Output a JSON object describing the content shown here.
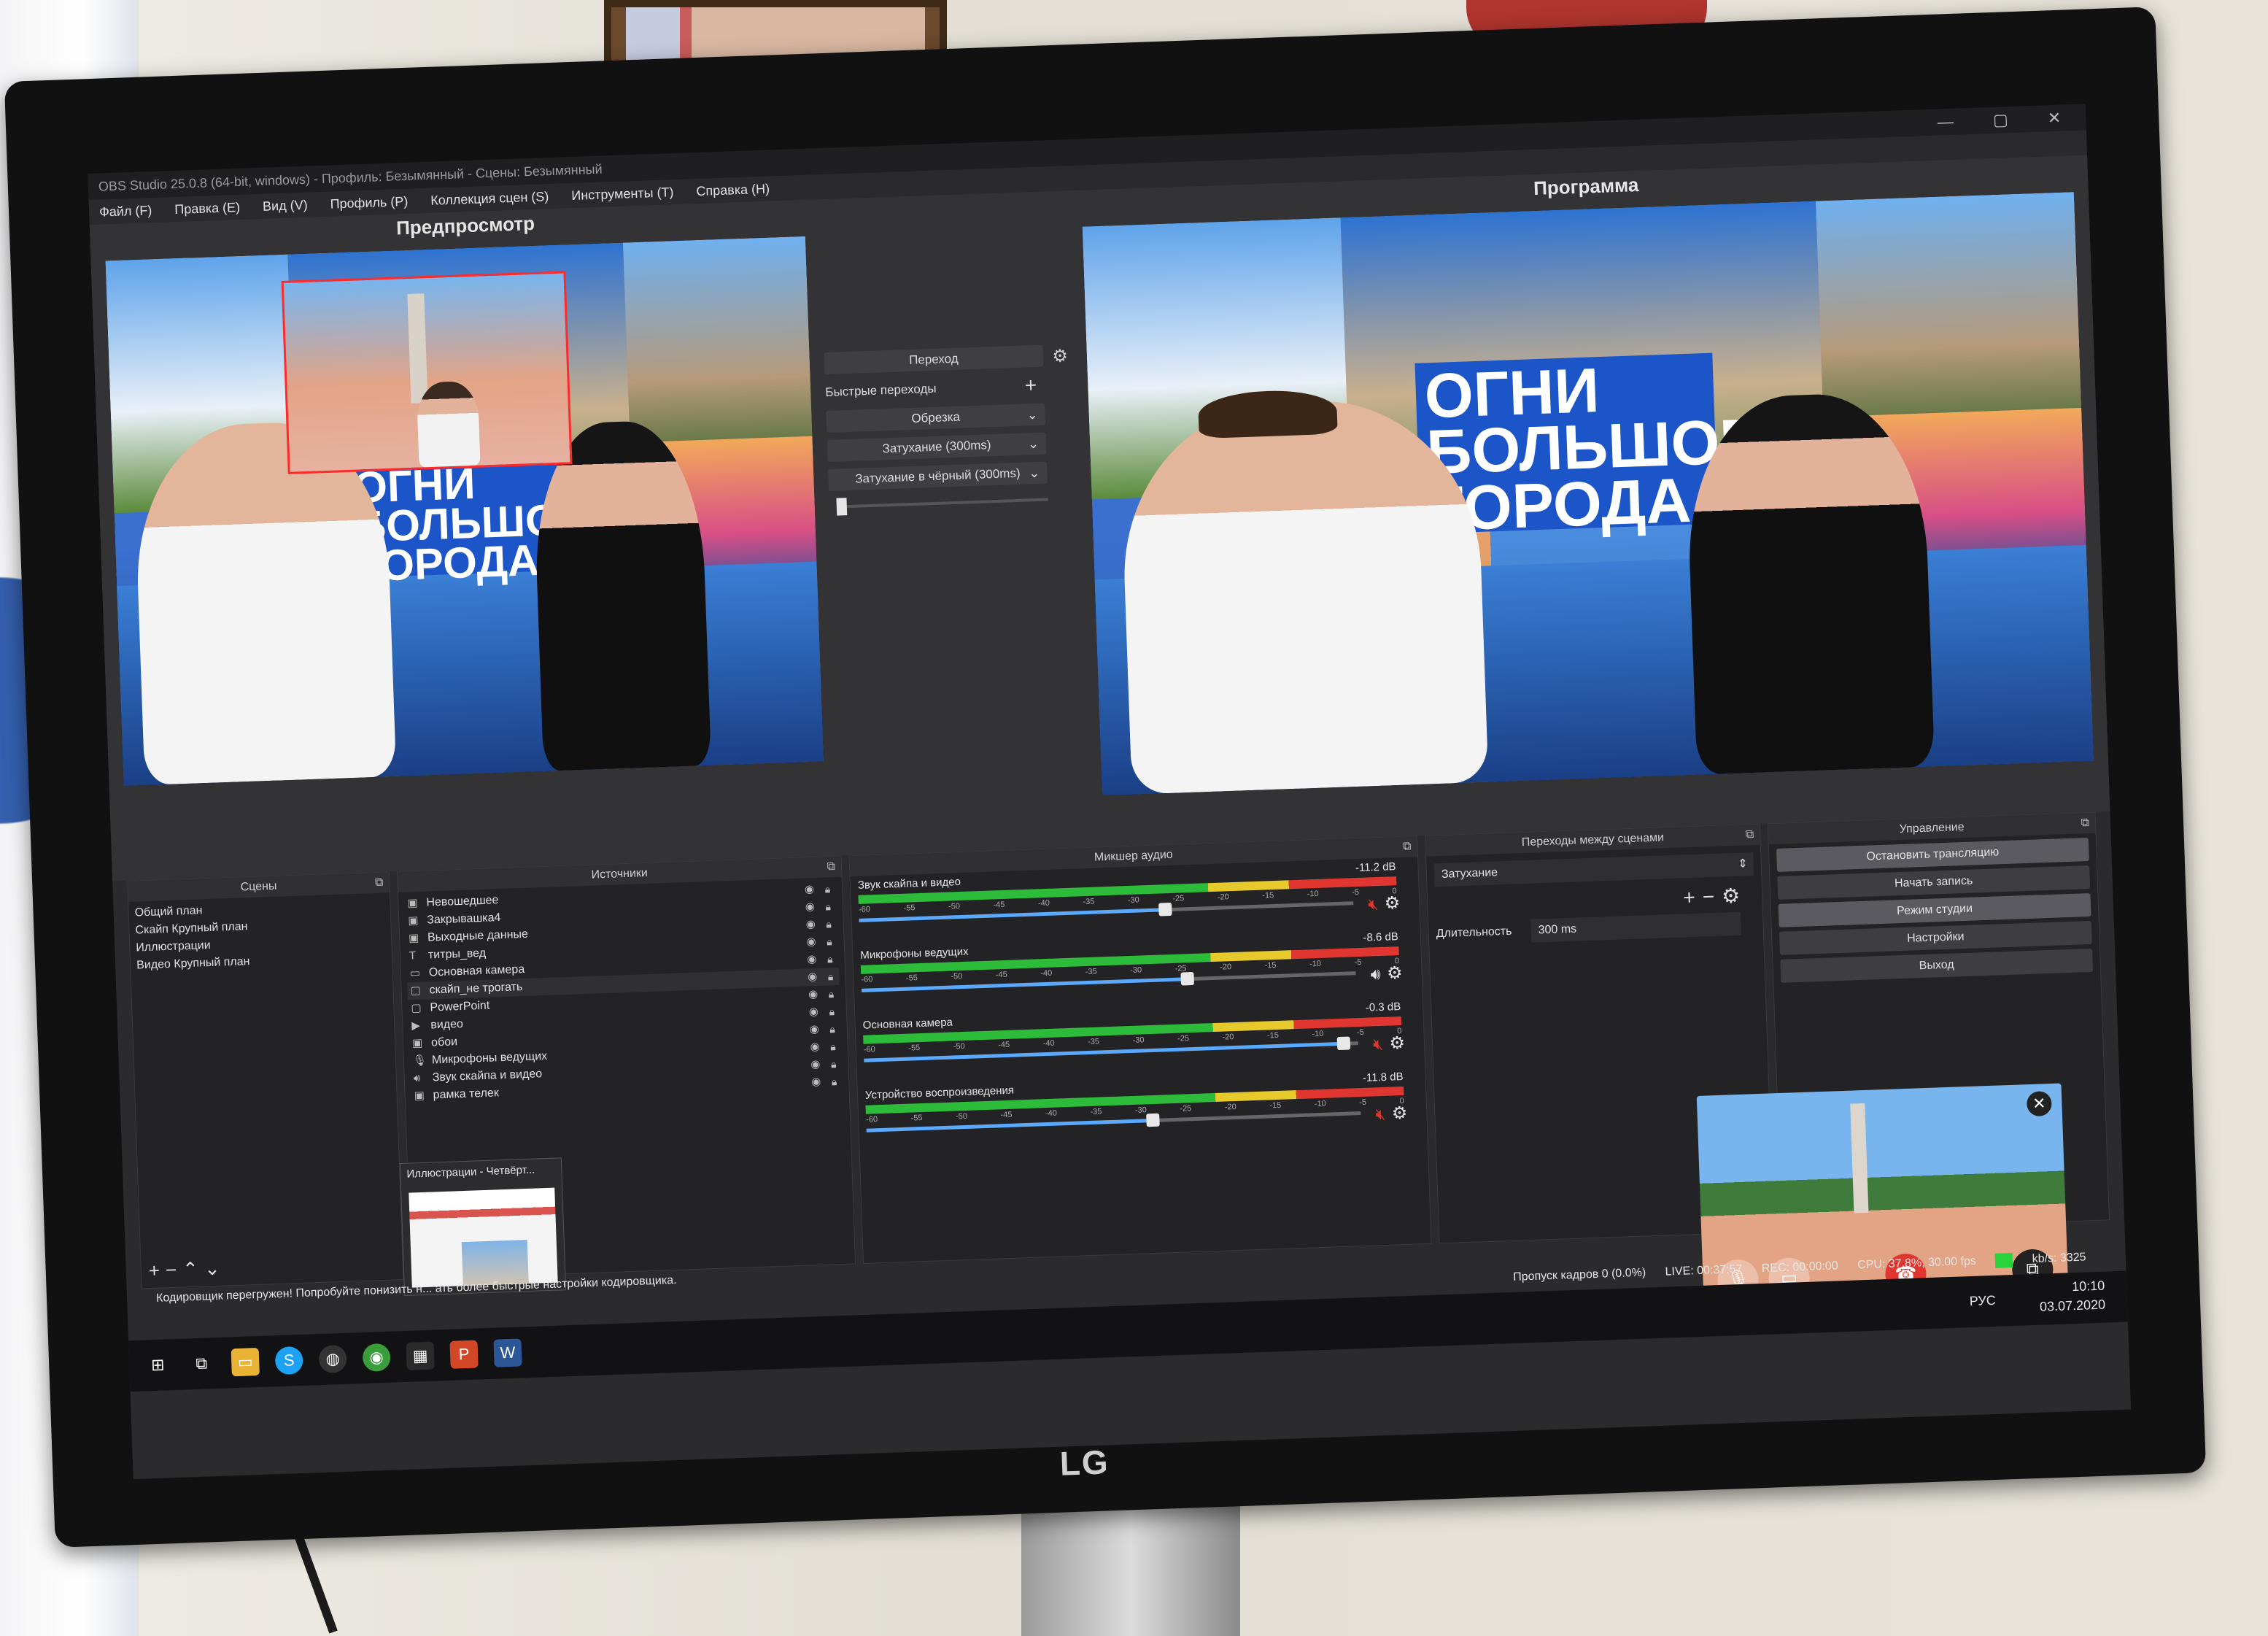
{
  "window": {
    "title": "OBS Studio 25.0.8 (64-bit, windows) - Профиль: Безымянный - Сцены: Безымянный"
  },
  "menu": [
    "Файл (F)",
    "Правка (E)",
    "Вид (V)",
    "Профиль (P)",
    "Коллекция сцен (S)",
    "Инструменты (T)",
    "Справка (H)"
  ],
  "preview": {
    "title": "Предпросмотр",
    "banner_text": "ОГНИ БОЛЬШОГО ГОРОДА"
  },
  "program": {
    "title": "Программа",
    "banner_text": "ОГНИ БОЛЬШОГО ГОРОДА"
  },
  "transition_panel": {
    "transition_button": "Переход",
    "quick_label": "Быстрые переходы",
    "quick_items": [
      "Обрезка",
      "Затухание (300ms)",
      "Затухание в чёрный (300ms)"
    ]
  },
  "scenes": {
    "title": "Сцены",
    "items": [
      "Общий план",
      "Скайп Крупный план",
      "Иллюстрации",
      "Видео Крупный план"
    ]
  },
  "sources": {
    "title": "Источники",
    "items": [
      "Невошедшее",
      "Закрывашка4",
      "Выходные данные",
      "титры_вед",
      "Основная камера",
      "скайп_не трогать",
      "PowerPoint",
      "видео",
      "обои",
      "Микрофоны ведущих",
      "Звук скайпа и видео",
      "рамка телек"
    ]
  },
  "mixer": {
    "title": "Микшер аудио",
    "channels": [
      {
        "name": "Звук скайпа и видео",
        "db": "-11.2 dB",
        "level": 0.62,
        "muted": true
      },
      {
        "name": "Микрофоны ведущих",
        "db": "-8.6 dB",
        "level": 0.66,
        "muted": false
      },
      {
        "name": "Основная камера",
        "db": "-0.3 dB",
        "level": 0.97,
        "muted": true
      },
      {
        "name": "Устройство воспроизведения",
        "db": "-11.8 dB",
        "level": 0.58,
        "muted": true
      }
    ],
    "ticks": [
      "-60",
      "-55",
      "-50",
      "-45",
      "-40",
      "-35",
      "-30",
      "-25",
      "-20",
      "-15",
      "-10",
      "-5",
      "0"
    ]
  },
  "scene_transitions": {
    "title": "Переходы между сценами",
    "selected": "Затухание",
    "duration_label": "Длительность",
    "duration_value": "300 ms"
  },
  "controls": {
    "title": "Управление",
    "buttons": [
      "Остановить трансляцию",
      "Начать запись",
      "Режим студии",
      "Настройки",
      "Выход"
    ]
  },
  "status": {
    "message": "Кодировщик перегружен! Попробуйте понизить н... ать более быстрые настройки кодировщика.",
    "dropped": "Пропуск кадров 0 (0.0%)",
    "live": "LIVE: 00:37:57",
    "rec": "REC: 00:00:00",
    "cpu": "CPU: 37.8%, 30.00 fps",
    "kbs": "kb/s: 3325"
  },
  "thumbnail": {
    "title": "Иллюстрации - Четвёрт..."
  },
  "taskbar": {
    "lang": "РУС",
    "time": "10:10",
    "date": "03.07.2020"
  },
  "tv": {
    "brand": "LG"
  },
  "colors": {
    "selection": "#ff2a2a",
    "banner": "#1b55c7",
    "meter_green": "#2dbb3a",
    "meter_yellow": "#e6c92a",
    "meter_red": "#e0362f",
    "fader_blue": "#5aa9ff"
  }
}
